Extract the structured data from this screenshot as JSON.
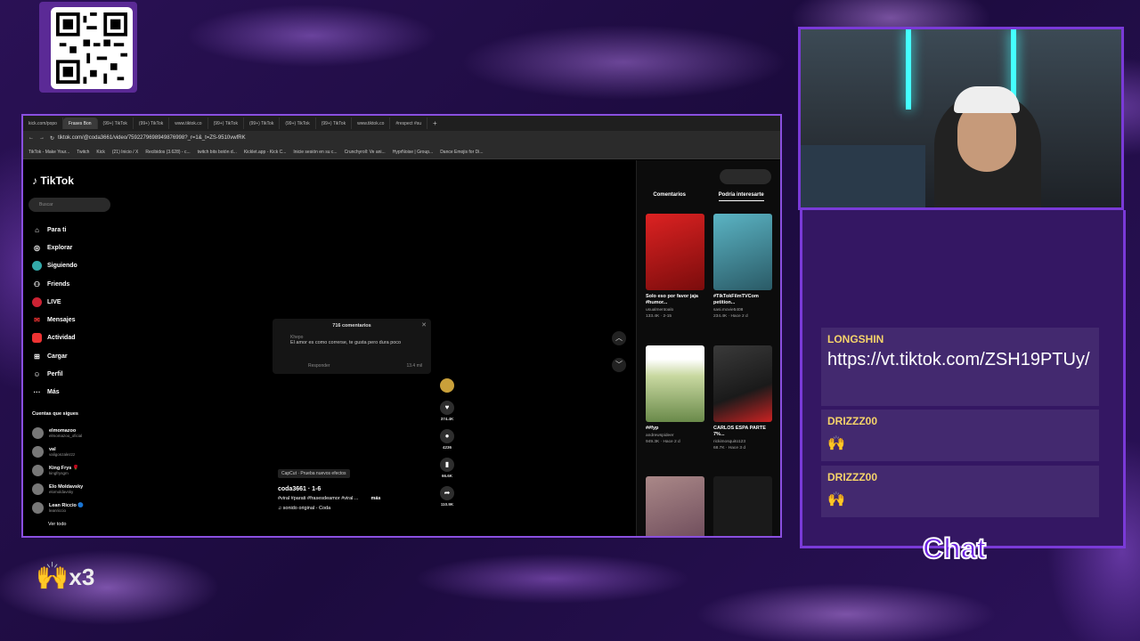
{
  "browser": {
    "tabs": [
      "kick.com/popo",
      "Frases Bon",
      "(99+) TikTok",
      "(99+) TikTok",
      "www.tiktok.co",
      "(99+) TikTok",
      "(99+) TikTok",
      "(99+) TikTok",
      "(99+) TikTok",
      "www.tiktok.co",
      "#respect #su"
    ],
    "url": "tiktok.com/@coda3661/video/7592279698949876998?_r=1&_t=ZS-9510vwfRK",
    "bookmarks": [
      "TikTok - Make Your...",
      "Twitch",
      "Kick",
      "(21) Inicio / X",
      "Recibidos (3.628) - c...",
      "twitch bits botón d...",
      "Kicklet.app - Kick C...",
      "Inicie sesión en su c...",
      "Crunchyroll: Ve ani...",
      "HyprNoise | Group...",
      "Dance Emojis for Di..."
    ]
  },
  "tiktok": {
    "logo": "TikTok",
    "search_placeholder": "Buscar",
    "nav": [
      "Para ti",
      "Explorar",
      "Siguiendo",
      "Friends",
      "LIVE",
      "Mensajes",
      "Actividad",
      "Cargar",
      "Perfil",
      "Más"
    ],
    "following_title": "Cuentas que sigues",
    "following": [
      {
        "name": "elmomazoo",
        "sub": "elmomazoo_oficial"
      },
      {
        "name": "val",
        "sub": "valigonzalezzz"
      },
      {
        "name": "King Frys 🌹",
        "sub": "kingfrysgm"
      },
      {
        "name": "Elo Moldavsky",
        "sub": "elomoldavsky"
      },
      {
        "name": "Lean Riccio 🔵",
        "sub": "leanriccio"
      }
    ],
    "see_all": "Ver todo",
    "comments": {
      "title": "716 comentarios",
      "user": "Khepo",
      "text": "El amor es como correrse, te gusta pero dura poco",
      "reply": "Responder",
      "likes": "13.4 mil"
    },
    "actions": [
      {
        "icon": "heart-icon",
        "count": "374.4K"
      },
      {
        "icon": "comment-icon",
        "count": "4236"
      },
      {
        "icon": "bookmark-icon",
        "count": "66.6K"
      },
      {
        "icon": "share-icon",
        "count": "110.9K"
      }
    ],
    "video": {
      "capcut": "CapCut · Prueba nuevos efectos",
      "author": "coda3661 · 1-6",
      "caption": "#viral #parati #frasesdeamor #viral ...",
      "more": "más",
      "sound": "sonido original - Coda"
    },
    "right_tabs": [
      "Comentarios",
      "Podría interesarte"
    ],
    "cards": [
      {
        "title": "Solo eso por favor jaja #humor...",
        "user": "usualmentoalo",
        "meta": "133.4K · 2-15",
        "color": "#b01a1a"
      },
      {
        "title": "#TikTokFilmTVCom petition...",
        "user": "sasi.movie5408",
        "meta": "234.4K · Hace 2 d",
        "color": "#3a8a9a"
      },
      {
        "title": "##fyp",
        "user": "andrewspideer",
        "meta": "949.3K · Hace 2 d",
        "color": "#a8b880"
      },
      {
        "title": "CARLOS ESPA PARTE 7%...",
        "user": "rickimosquito123",
        "meta": "68.7K · Hace 3 d",
        "color": "#5a4a4a"
      }
    ]
  },
  "chat": {
    "messages": [
      {
        "user": "LONGSHIN",
        "text": "https://vt.tiktok.com/ZSH19PTUy/"
      },
      {
        "user": "DRIZZZ00",
        "text": "🙌"
      },
      {
        "user": "DRIZZZ00",
        "text": "🙌"
      }
    ],
    "label": "Chat"
  },
  "overlay": {
    "hands_label": "x3"
  }
}
